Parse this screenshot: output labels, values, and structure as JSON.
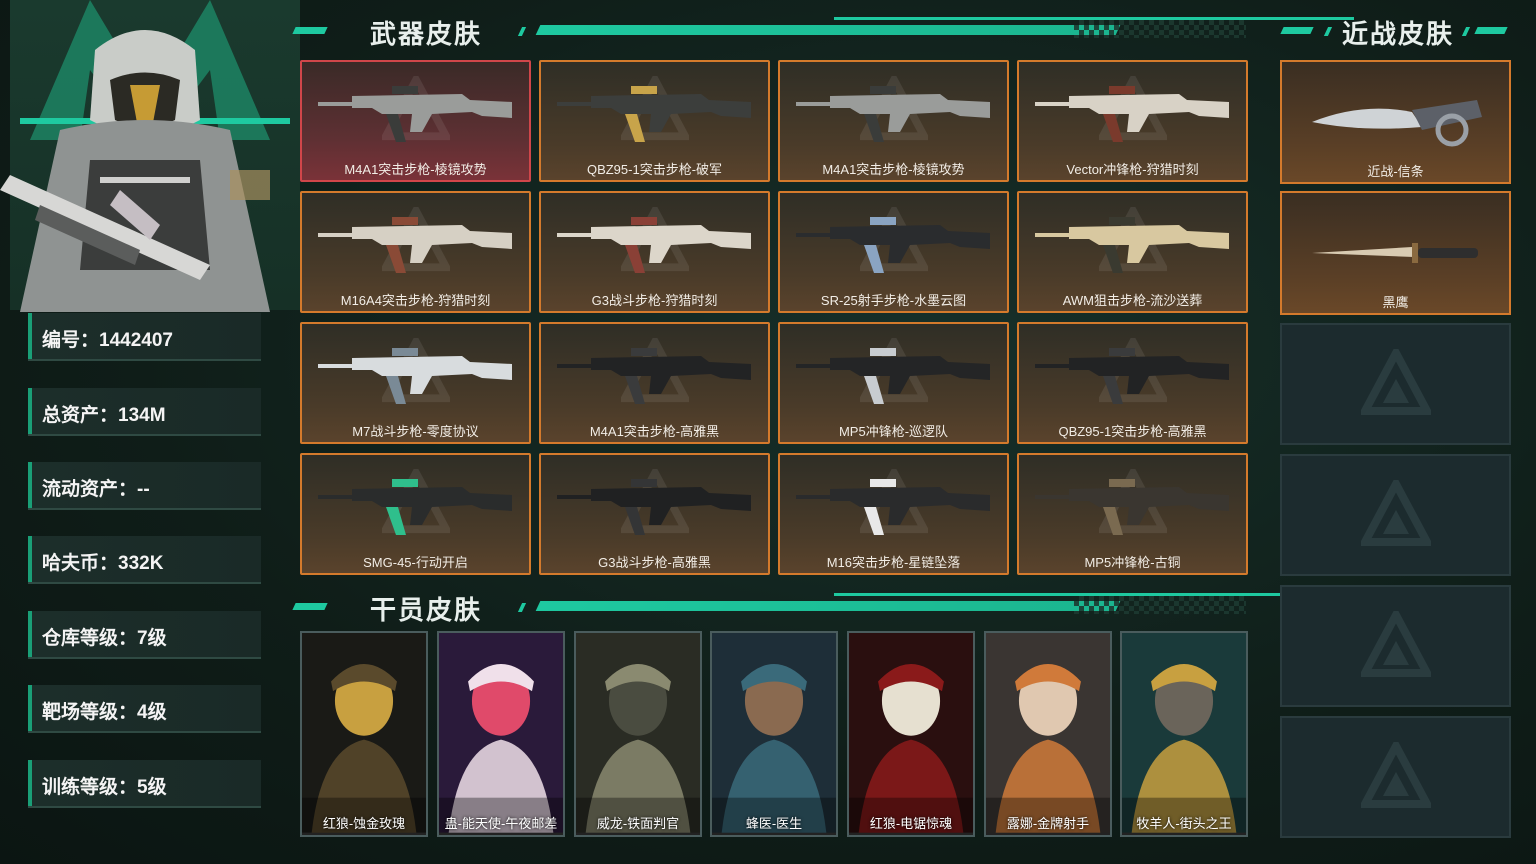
{
  "profile": {
    "stats": [
      "编号：1442407",
      "总资产：134M",
      "流动资产：--",
      "哈夫币：332K",
      "仓库等级：7级",
      "靶场等级：4级",
      "训练等级：5级"
    ]
  },
  "sections": {
    "weapon_title": "武器皮肤",
    "melee_title": "近战皮肤",
    "operator_title": "干员皮肤"
  },
  "weapons": [
    "M4A1突击步枪-棱镜攻势",
    "QBZ95-1突击步枪-破军",
    "M4A1突击步枪-棱镜攻势",
    "Vector冲锋枪-狩猎时刻",
    "M16A4突击步枪-狩猎时刻",
    "G3战斗步枪-狩猎时刻",
    "SR-25射手步枪-水墨云图",
    "AWM狙击步枪-流沙送葬",
    "M7战斗步枪-零度协议",
    "M4A1突击步枪-高雅黑",
    "MP5冲锋枪-巡逻队",
    "QBZ95-1突击步枪-高雅黑",
    "SMG-45-行动开启",
    "G3战斗步枪-高雅黑",
    "M16突击步枪-星链坠落",
    "MP5冲锋枪-古铜"
  ],
  "melee": [
    "近战-信条",
    "黑鹰"
  ],
  "operators": [
    "红狼-蚀金玫瑰",
    "蛊-能天使-午夜邮差",
    "威龙-铁面判官",
    "蜂医-医生",
    "红狼-电锯惊魂",
    "露娜-金牌射手",
    "牧羊人-街头之王"
  ],
  "colors": {
    "accent": "#1ec9a0",
    "gold_border": "#d47a2c",
    "red_border": "#d0464a"
  }
}
